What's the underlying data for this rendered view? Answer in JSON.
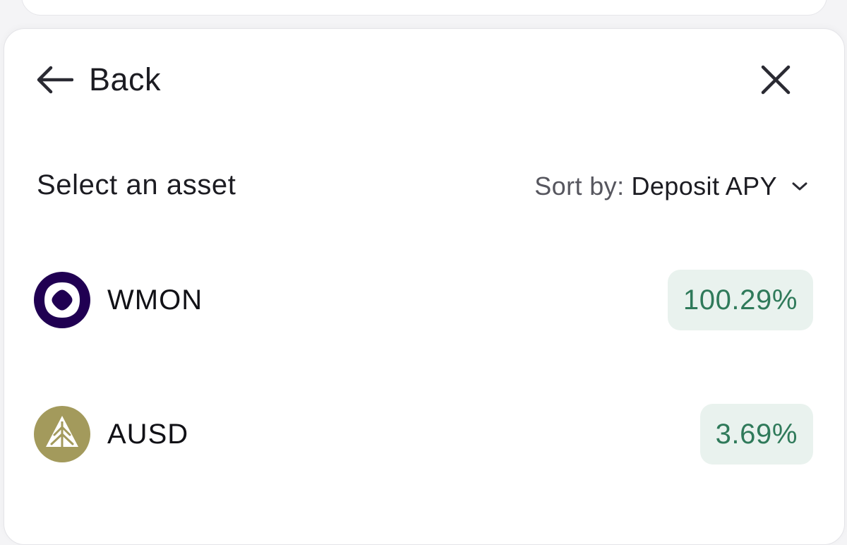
{
  "header": {
    "back_label": "Back",
    "back_icon": "arrow-left-icon",
    "close_icon": "close-icon"
  },
  "section": {
    "title": "Select an asset"
  },
  "sort": {
    "prefix": "Sort by:",
    "value": "Deposit APY",
    "icon": "chevron-down-icon"
  },
  "assets": [
    {
      "symbol": "WMON",
      "apy": "100.29%",
      "icon": "wmon-token-icon",
      "icon_color": "#200052"
    },
    {
      "symbol": "AUSD",
      "apy": "3.69%",
      "icon": "ausd-token-icon",
      "icon_color": "#a39a5c"
    }
  ],
  "colors": {
    "apy_text": "#2f7a5a",
    "apy_bg": "#e9f2ee"
  }
}
